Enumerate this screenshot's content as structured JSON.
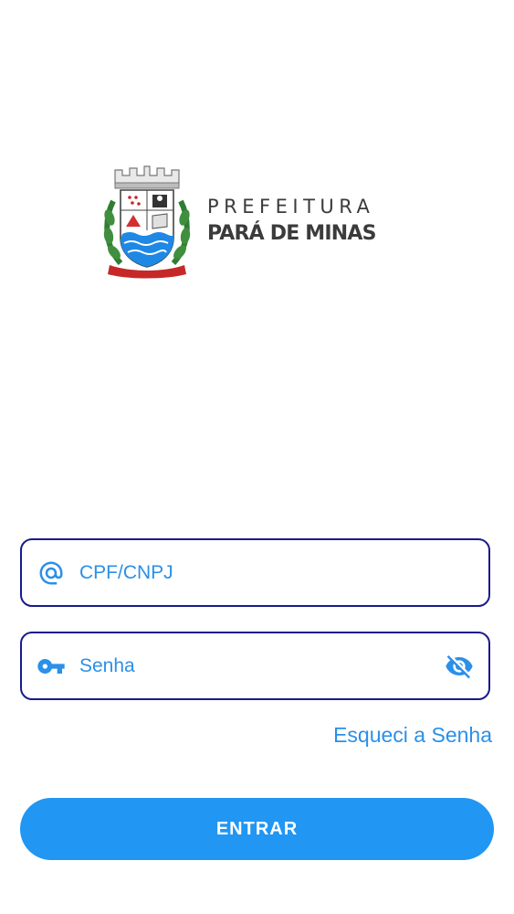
{
  "brand": {
    "line1": "PREFEITURA",
    "line2": "PARÁ DE MINAS",
    "crest_icon": "city-coat-of-arms"
  },
  "login": {
    "cpf_placeholder": "CPF/CNPJ",
    "cpf_value": "",
    "cpf_icon": "at-sign-icon",
    "password_placeholder": "Senha",
    "password_value": "",
    "password_icon": "key-icon",
    "visibility_icon": "eye-off-icon",
    "forgot_label": "Esqueci a Senha",
    "submit_label": "ENTRAR"
  },
  "colors": {
    "accent": "#2196f3",
    "link": "#2a90e8",
    "field_border": "#1a1a8c",
    "logo_text": "#3b3b3b"
  }
}
